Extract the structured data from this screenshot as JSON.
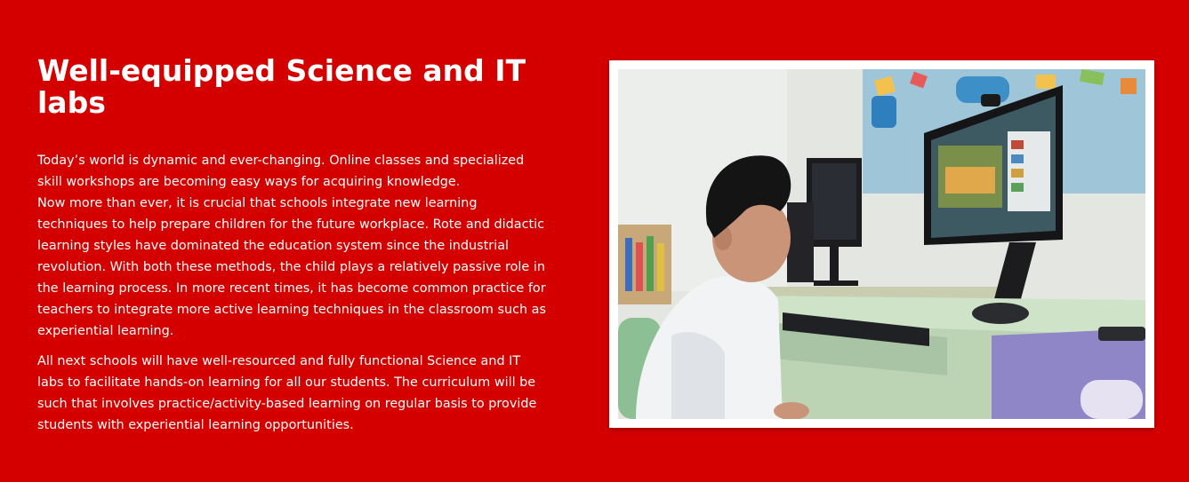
{
  "section": {
    "title": "Well-equipped Science and IT labs",
    "paragraphs": [
      "Today’s world is dynamic and ever-changing. Online classes and specialized skill workshops are becoming easy ways for acquiring knowledge.",
      "Now more than ever, it is crucial that schools integrate new learning techniques to help prepare children for the future workplace. Rote and didactic learning styles have dominated the education system since the industrial revolution. With both these methods, the child plays a relatively passive role in the learning process. In more recent times, it has become common practice for teachers to integrate more active learning techniques in the classroom such as experiential learning.",
      "All next schools will have well-resourced and fully functional Science and IT labs to facilitate hands-on learning for all our students. The curriculum will be such that involves practice/activity-based learning on regular basis to provide students with experiential learning opportunities."
    ]
  },
  "colors": {
    "background": "#d40000",
    "text": "#ffffff",
    "frame": "#ffffff"
  }
}
